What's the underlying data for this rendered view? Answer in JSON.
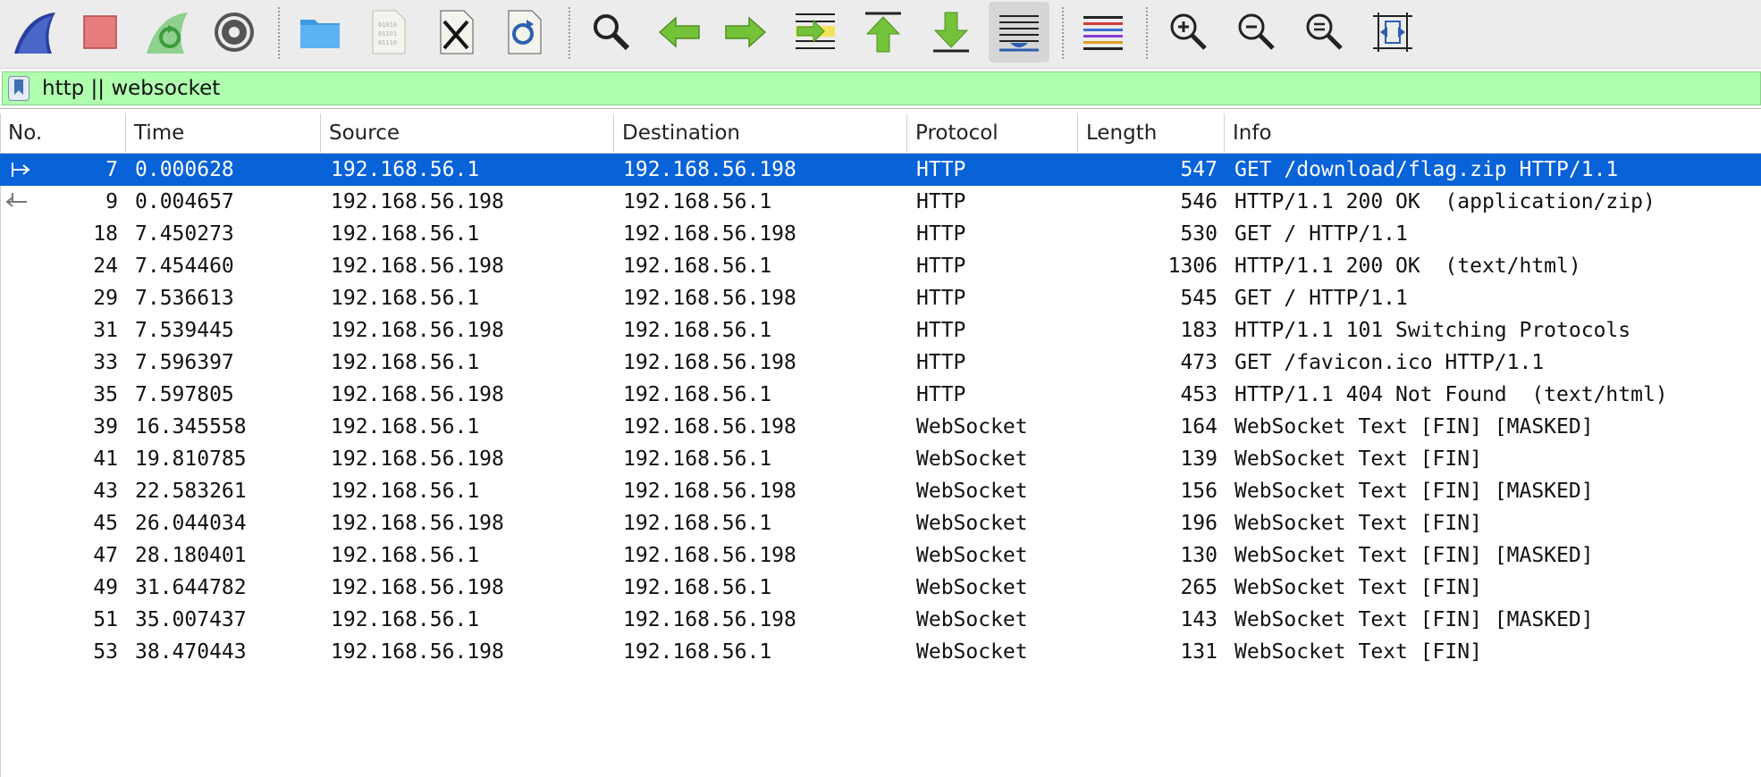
{
  "toolbar": {
    "buttons": [
      {
        "name": "start-capture"
      },
      {
        "name": "stop-capture"
      },
      {
        "name": "restart-capture"
      },
      {
        "name": "capture-options"
      },
      {
        "name": "open-file"
      },
      {
        "name": "save-file"
      },
      {
        "name": "close-file"
      },
      {
        "name": "reload-file"
      },
      {
        "name": "find-packet"
      },
      {
        "name": "go-back"
      },
      {
        "name": "go-forward"
      },
      {
        "name": "go-to-packet"
      },
      {
        "name": "go-to-first-packet"
      },
      {
        "name": "go-to-last-packet"
      },
      {
        "name": "auto-scroll"
      },
      {
        "name": "colorize"
      },
      {
        "name": "zoom-in"
      },
      {
        "name": "zoom-out"
      },
      {
        "name": "normal-size"
      },
      {
        "name": "resize-columns"
      }
    ]
  },
  "filter": {
    "value": "http || websocket",
    "background_color": "#afffaf"
  },
  "columns": [
    "No.",
    "Time",
    "Source",
    "Destination",
    "Protocol",
    "Length",
    "Info"
  ],
  "packets": [
    {
      "no": "7",
      "time": "0.000628",
      "source": "192.168.56.1",
      "destination": "192.168.56.198",
      "protocol": "HTTP",
      "length": "547",
      "info": "GET /download/flag.zip HTTP/1.1",
      "selected": true
    },
    {
      "no": "9",
      "time": "0.004657",
      "source": "192.168.56.198",
      "destination": "192.168.56.1",
      "protocol": "HTTP",
      "length": "546",
      "info": "HTTP/1.1 200 OK  (application/zip)"
    },
    {
      "no": "18",
      "time": "7.450273",
      "source": "192.168.56.1",
      "destination": "192.168.56.198",
      "protocol": "HTTP",
      "length": "530",
      "info": "GET / HTTP/1.1"
    },
    {
      "no": "24",
      "time": "7.454460",
      "source": "192.168.56.198",
      "destination": "192.168.56.1",
      "protocol": "HTTP",
      "length": "1306",
      "info": "HTTP/1.1 200 OK  (text/html)"
    },
    {
      "no": "29",
      "time": "7.536613",
      "source": "192.168.56.1",
      "destination": "192.168.56.198",
      "protocol": "HTTP",
      "length": "545",
      "info": "GET / HTTP/1.1"
    },
    {
      "no": "31",
      "time": "7.539445",
      "source": "192.168.56.198",
      "destination": "192.168.56.1",
      "protocol": "HTTP",
      "length": "183",
      "info": "HTTP/1.1 101 Switching Protocols"
    },
    {
      "no": "33",
      "time": "7.596397",
      "source": "192.168.56.1",
      "destination": "192.168.56.198",
      "protocol": "HTTP",
      "length": "473",
      "info": "GET /favicon.ico HTTP/1.1"
    },
    {
      "no": "35",
      "time": "7.597805",
      "source": "192.168.56.198",
      "destination": "192.168.56.1",
      "protocol": "HTTP",
      "length": "453",
      "info": "HTTP/1.1 404 Not Found  (text/html)"
    },
    {
      "no": "39",
      "time": "16.345558",
      "source": "192.168.56.1",
      "destination": "192.168.56.198",
      "protocol": "WebSocket",
      "length": "164",
      "info": "WebSocket Text [FIN] [MASKED]"
    },
    {
      "no": "41",
      "time": "19.810785",
      "source": "192.168.56.198",
      "destination": "192.168.56.1",
      "protocol": "WebSocket",
      "length": "139",
      "info": "WebSocket Text [FIN]"
    },
    {
      "no": "43",
      "time": "22.583261",
      "source": "192.168.56.1",
      "destination": "192.168.56.198",
      "protocol": "WebSocket",
      "length": "156",
      "info": "WebSocket Text [FIN] [MASKED]"
    },
    {
      "no": "45",
      "time": "26.044034",
      "source": "192.168.56.198",
      "destination": "192.168.56.1",
      "protocol": "WebSocket",
      "length": "196",
      "info": "WebSocket Text [FIN]"
    },
    {
      "no": "47",
      "time": "28.180401",
      "source": "192.168.56.1",
      "destination": "192.168.56.198",
      "protocol": "WebSocket",
      "length": "130",
      "info": "WebSocket Text [FIN] [MASKED]"
    },
    {
      "no": "49",
      "time": "31.644782",
      "source": "192.168.56.198",
      "destination": "192.168.56.1",
      "protocol": "WebSocket",
      "length": "265",
      "info": "WebSocket Text [FIN]"
    },
    {
      "no": "51",
      "time": "35.007437",
      "source": "192.168.56.1",
      "destination": "192.168.56.198",
      "protocol": "WebSocket",
      "length": "143",
      "info": "WebSocket Text [FIN] [MASKED]"
    },
    {
      "no": "53",
      "time": "38.470443",
      "source": "192.168.56.198",
      "destination": "192.168.56.1",
      "protocol": "WebSocket",
      "length": "131",
      "info": "WebSocket Text [FIN]"
    }
  ],
  "colors": {
    "selected_row": "#0862d8",
    "toolbar_bg": "#ececec"
  }
}
